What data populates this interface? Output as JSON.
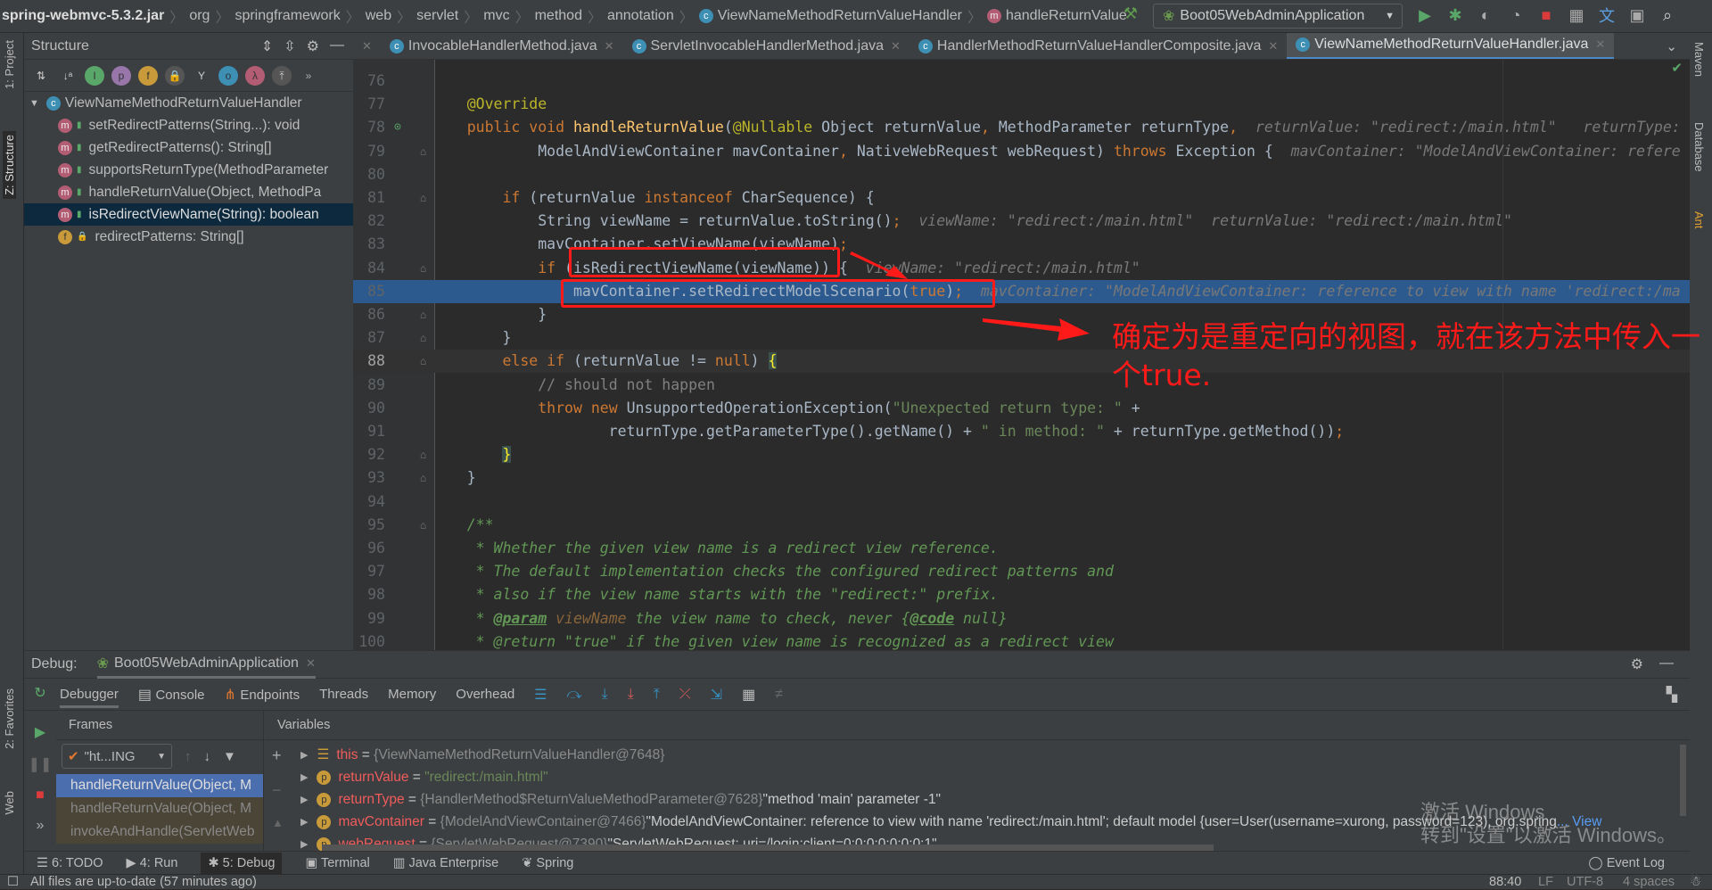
{
  "navbar": {
    "breadcrumbs": [
      "spring-webmvc-5.3.2.jar",
      "org",
      "springframework",
      "web",
      "servlet",
      "mvc",
      "method",
      "annotation",
      "ViewNameMethodReturnValueHandler",
      "handleReturnValue"
    ],
    "run_config": "Boot05WebAdminApplication"
  },
  "left_strip": {
    "project": "1: Project",
    "structure": "Z: Structure",
    "favorites": "2: Favorites",
    "web": "Web"
  },
  "right_strip": {
    "maven": "Maven",
    "database": "Database",
    "ant": "Ant"
  },
  "structure": {
    "title": "Structure",
    "root": "ViewNameMethodReturnValueHandler",
    "items": [
      {
        "kind": "m",
        "label": "setRedirectPatterns(String...): void"
      },
      {
        "kind": "m",
        "label": "getRedirectPatterns(): String[]"
      },
      {
        "kind": "m",
        "label": "supportsReturnType(MethodParameter"
      },
      {
        "kind": "m",
        "label": "handleReturnValue(Object, MethodPa"
      },
      {
        "kind": "m",
        "label": "isRedirectViewName(String): boolean",
        "selected": true
      },
      {
        "kind": "f",
        "label": "redirectPatterns: String[]"
      }
    ]
  },
  "tabs": [
    {
      "label": "InvocableHandlerMethod.java"
    },
    {
      "label": "ServletInvocableHandlerMethod.java"
    },
    {
      "label": "HandlerMethodReturnValueHandlerComposite.java"
    },
    {
      "label": "ViewNameMethodReturnValueHandler.java",
      "active": true
    }
  ],
  "editor": {
    "current_line": 88,
    "execution_line": 85,
    "lines": [
      {
        "n": 76,
        "segs": []
      },
      {
        "n": 77,
        "segs": [
          [
            "",
            "    "
          ],
          [
            "ann",
            "@Override"
          ]
        ]
      },
      {
        "n": 78,
        "segs": [
          [
            "",
            "    "
          ],
          [
            "kw",
            "public void "
          ],
          [
            "fn",
            "handleReturnValue"
          ],
          [
            "",
            "("
          ],
          [
            "ann",
            "@Nullable"
          ],
          [
            "",
            " Object returnValue"
          ],
          [
            "kw",
            ", "
          ],
          [
            "",
            "MethodParameter returnType"
          ],
          [
            "kw",
            ","
          ],
          [
            "hint",
            "  returnValue: \"redirect:/main.html\"   returnType: "
          ]
        ]
      },
      {
        "n": 79,
        "segs": [
          [
            "",
            "            ModelAndViewContainer mavContainer"
          ],
          [
            "kw",
            ", "
          ],
          [
            "",
            "NativeWebRequest webRequest) "
          ],
          [
            "kw",
            "throws "
          ],
          [
            "",
            "Exception {"
          ],
          [
            "hint",
            "  mavContainer: \"ModelAndViewContainer: refere"
          ]
        ]
      },
      {
        "n": 80,
        "segs": []
      },
      {
        "n": 81,
        "segs": [
          [
            "",
            "        "
          ],
          [
            "kw",
            "if "
          ],
          [
            "",
            "(returnValue "
          ],
          [
            "kw",
            "instanceof "
          ],
          [
            "",
            "CharSequence) {"
          ]
        ]
      },
      {
        "n": 82,
        "segs": [
          [
            "",
            "            String viewName = returnValue.toString()"
          ],
          [
            "kw",
            ";"
          ],
          [
            "hint",
            "  viewName: \"redirect:/main.html\"  returnValue: \"redirect:/main.html\""
          ]
        ]
      },
      {
        "n": 83,
        "segs": [
          [
            "",
            "            mavContainer.setViewName(viewName)"
          ],
          [
            "kw",
            ";"
          ]
        ]
      },
      {
        "n": 84,
        "segs": [
          [
            "",
            "            "
          ],
          [
            "kw",
            "if "
          ],
          [
            "",
            "(isRedirectViewName(viewName)) {"
          ],
          [
            "hint",
            "  viewName: \"redirect:/main.html\""
          ]
        ]
      },
      {
        "n": 85,
        "segs": [
          [
            "",
            "                mavContainer.setRedirectModelScenario("
          ],
          [
            "kw",
            "true"
          ],
          [
            "",
            ")"
          ],
          [
            "kw",
            ";"
          ],
          [
            "hint",
            "  mavContainer: \"ModelAndViewContainer: reference to view with name 'redirect:/ma"
          ]
        ]
      },
      {
        "n": 86,
        "segs": [
          [
            "",
            "            }"
          ]
        ]
      },
      {
        "n": 87,
        "segs": [
          [
            "",
            "        }"
          ]
        ]
      },
      {
        "n": 88,
        "segs": [
          [
            "",
            "        "
          ],
          [
            "kw",
            "else if "
          ],
          [
            "",
            "(returnValue != "
          ],
          [
            "kw",
            "null"
          ],
          [
            "",
            ") "
          ],
          [
            "brace",
            "{"
          ]
        ]
      },
      {
        "n": 89,
        "segs": [
          [
            "",
            "            "
          ],
          [
            "cm",
            "// should not happen"
          ]
        ]
      },
      {
        "n": 90,
        "segs": [
          [
            "",
            "            "
          ],
          [
            "kw",
            "throw new "
          ],
          [
            "",
            "UnsupportedOperationException("
          ],
          [
            "str",
            "\"Unexpected return type: \""
          ],
          [
            "",
            " +"
          ]
        ]
      },
      {
        "n": 91,
        "segs": [
          [
            "",
            "                    returnType.getParameterType().getName() + "
          ],
          [
            "str",
            "\" in method: \""
          ],
          [
            "",
            " + returnType.getMethod())"
          ],
          [
            "kw",
            ";"
          ]
        ]
      },
      {
        "n": 92,
        "segs": [
          [
            "",
            "        "
          ],
          [
            "brace",
            "}"
          ]
        ]
      },
      {
        "n": 93,
        "segs": [
          [
            "",
            "    }"
          ]
        ]
      },
      {
        "n": 94,
        "segs": []
      },
      {
        "n": 95,
        "segs": [
          [
            "",
            "    "
          ],
          [
            "doc",
            "/**"
          ]
        ]
      },
      {
        "n": 96,
        "segs": [
          [
            "",
            "     "
          ],
          [
            "doc",
            "* Whether the given view name is a redirect view reference."
          ]
        ]
      },
      {
        "n": 97,
        "segs": [
          [
            "",
            "     "
          ],
          [
            "doc",
            "* The default implementation checks the configured redirect patterns and"
          ]
        ]
      },
      {
        "n": 98,
        "segs": [
          [
            "",
            "     "
          ],
          [
            "doc",
            "* also if the view name starts with the \"redirect:\" prefix."
          ]
        ]
      },
      {
        "n": 99,
        "segs": [
          [
            "",
            "     "
          ],
          [
            "doc",
            "* "
          ],
          [
            "tag",
            "@param"
          ],
          [
            "docp",
            " viewName"
          ],
          [
            "doc",
            " the view name to check, never {"
          ],
          [
            "tag",
            "@code"
          ],
          [
            "doc",
            " null}"
          ]
        ]
      },
      {
        "n": 100,
        "segs": [
          [
            "",
            "     "
          ],
          [
            "doc",
            "* @return \"true\" if the given view name is recognized as a redirect view"
          ]
        ]
      }
    ]
  },
  "annotation": {
    "note": "确定为是重定向的视图，就在该方法中传入一个true.",
    "color": "#ff1a1a"
  },
  "debug": {
    "label": "Debug:",
    "session": "Boot05WebAdminApplication",
    "tabs": [
      "Debugger",
      "Console",
      "Endpoints",
      "Threads",
      "Memory",
      "Overhead"
    ],
    "frames_title": "Frames",
    "thread_select": "\"ht...ING",
    "frames": [
      "handleReturnValue(Object, M",
      "handleReturnValue(Object, M",
      "invokeAndHandle(ServletWeb"
    ],
    "variables_title": "Variables",
    "variables": [
      {
        "icon": "field-list",
        "name": "this",
        "ref": "{ViewNameMethodReturnValueHandler@7648}",
        "value": ""
      },
      {
        "icon": "p",
        "name": "returnValue",
        "ref": "",
        "value": "\"redirect:/main.html\"",
        "is_string": true
      },
      {
        "icon": "p",
        "name": "returnType",
        "ref": "{HandlerMethod$ReturnValueMethodParameter@7628}",
        "value": "\"method 'main' parameter -1\""
      },
      {
        "icon": "p",
        "name": "mavContainer",
        "ref": "{ModelAndViewContainer@7466}",
        "value": "\"ModelAndViewContainer: reference to view with name 'redirect:/main.html'; default model {user=User(username=xurong, password=123), org.spring",
        "more": "... View"
      },
      {
        "icon": "p",
        "name": "webRequest",
        "ref": "{ServletWebRequest@7390}",
        "value": "\"ServletWebRequest: uri=/login;client=0:0:0:0:0:0:0:1\""
      }
    ]
  },
  "bottom_tools": [
    "6: TODO",
    "4: Run",
    "5: Debug",
    "Terminal",
    "Java Enterprise",
    "Spring"
  ],
  "event_log": "Event Log",
  "status": {
    "message": "All files are up-to-date (57 minutes ago)",
    "position": "88:40",
    "line_sep": "LF",
    "encoding": "UTF-8",
    "indent": "4 spaces"
  },
  "watermark": {
    "line1": "激活 Windows",
    "line2": "转到\"设置\"以激活 Windows。"
  }
}
